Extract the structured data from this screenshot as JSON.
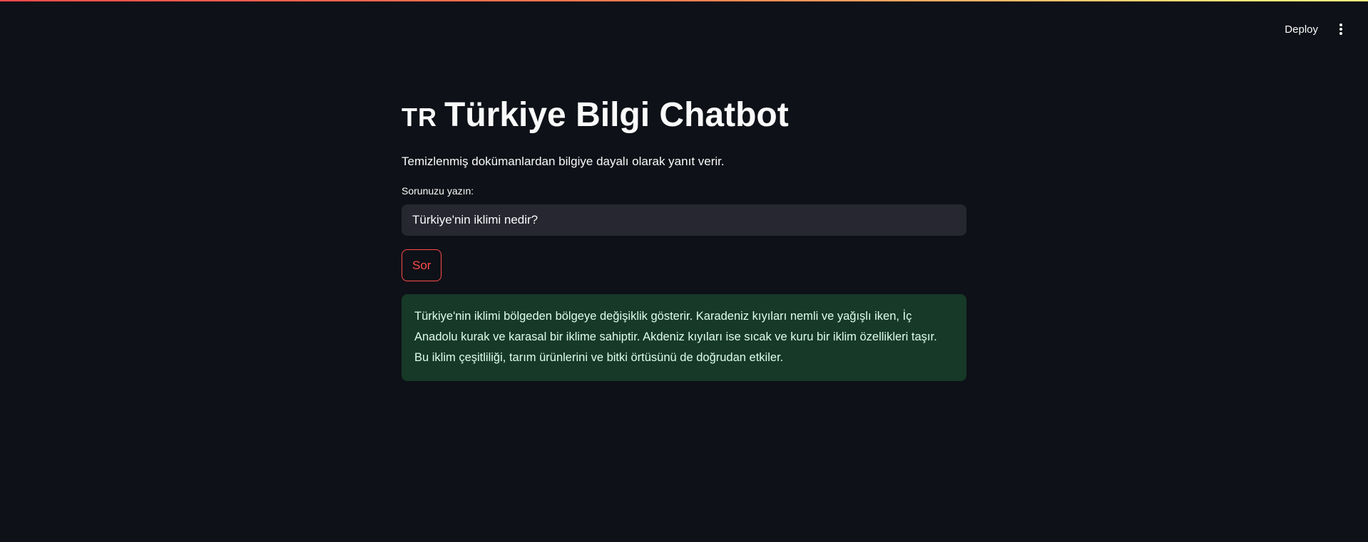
{
  "header": {
    "deploy_label": "Deploy",
    "menu_icon": "vertical-dots-icon"
  },
  "main": {
    "title_flag": "TR",
    "title": "Türkiye Bilgi Chatbot",
    "subtitle": "Temizlenmiş dokümanlardan bilgiye dayalı olarak yanıt verir.",
    "input_label": "Sorunuzu yazın:",
    "input_value": "Türkiye'nin iklimi nedir?",
    "submit_label": "Sor",
    "answer": "Türkiye'nin iklimi bölgeden bölgeye değişiklik gösterir. Karadeniz kıyıları nemli ve yağışlı iken, İç Anadolu kurak ve karasal bir iklime sahiptir. Akdeniz kıyıları ise sıcak ve kuru bir iklim özellikleri taşır. Bu iklim çeşitliliği, tarım ürünlerini ve bitki örtüsünü de doğrudan etkiler."
  },
  "colors": {
    "background": "#0e1117",
    "primary": "#ff4b4b",
    "input_bg": "#262730",
    "success_bg": "#173928",
    "success_text": "#dffde9"
  }
}
